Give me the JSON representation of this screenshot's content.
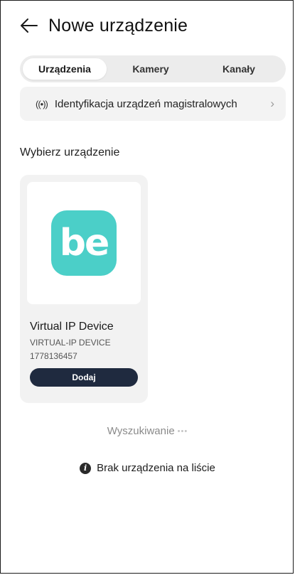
{
  "header": {
    "title": "Nowe urządzenie",
    "back_icon": "arrow-left-icon"
  },
  "tabs": [
    {
      "label": "Urządzenia",
      "active": true
    },
    {
      "label": "Kamery",
      "active": false
    },
    {
      "label": "Kanały",
      "active": false
    }
  ],
  "identification": {
    "icon": "broadcast-icon",
    "icon_glyph": "((•))",
    "label": "Identyfikacja urządzeń magistralowych",
    "chevron": "›"
  },
  "section": {
    "title": "Wybierz urządzenie"
  },
  "devices": [
    {
      "logo_text": "be",
      "name": "Virtual IP Device",
      "model": "VIRTUAL-IP DEVICE",
      "serial": "1778136457",
      "add_label": "Dodaj",
      "logo_color": "#4bcfc8"
    }
  ],
  "search": {
    "label": "Wyszukiwanie",
    "dots": "•••"
  },
  "no_device": {
    "icon": "info-icon",
    "icon_glyph": "i",
    "label": "Brak urządzenia na liście"
  },
  "colors": {
    "accent_dark": "#1f2a3f",
    "brand": "#4bcfc8"
  }
}
